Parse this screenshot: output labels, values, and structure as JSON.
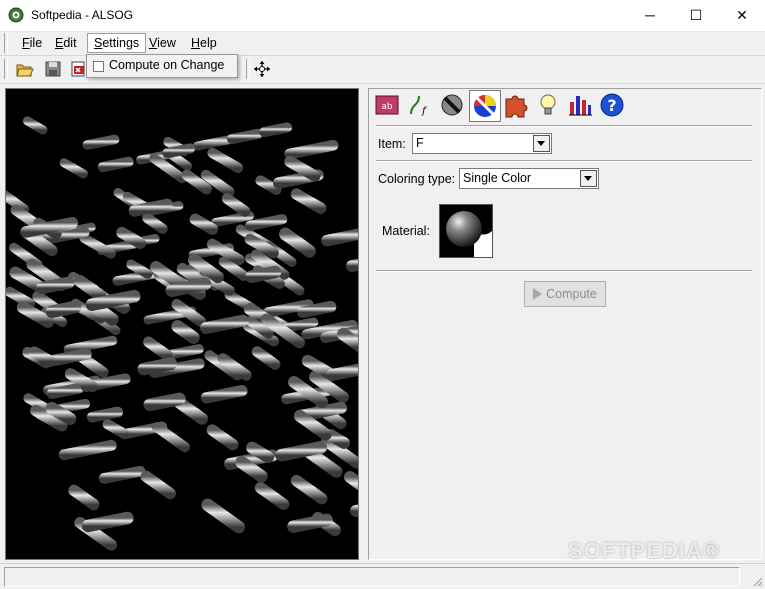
{
  "window": {
    "title": "Softpedia - ALSOG",
    "minimize_glyph": "─",
    "maximize_glyph": "☐",
    "close_glyph": "✕"
  },
  "menubar": {
    "items": [
      {
        "mnemonic": "F",
        "rest": "ile"
      },
      {
        "mnemonic": "E",
        "rest": "dit"
      },
      {
        "mnemonic": "S",
        "rest": "ettings"
      },
      {
        "mnemonic": "V",
        "rest": "iew"
      },
      {
        "mnemonic": "H",
        "rest": "elp"
      }
    ]
  },
  "settings_menu": {
    "compute_on_change_label": "Compute on Change",
    "compute_on_change_checked": false
  },
  "toolbar": {
    "icons": [
      "open-folder-icon",
      "save-icon",
      "export-icon",
      "move-crosshair-icon"
    ]
  },
  "tabs": [
    "lsystem-rules-icon",
    "function-icon",
    "shape-icon",
    "color-palette-icon",
    "puzzle-piece-icon",
    "light-bulb-icon",
    "bar-chart-icon",
    "help-icon"
  ],
  "form": {
    "item_label": "Item:",
    "item_value": "F",
    "coloring_type_label": "Coloring type:",
    "coloring_type_value": "Single Color",
    "material_label": "Material:",
    "compute_label": "Compute"
  },
  "watermark": "SOFTPEDIA®",
  "colors": {
    "viewport_bg": "#000000",
    "tube": "#b4b4b4"
  }
}
